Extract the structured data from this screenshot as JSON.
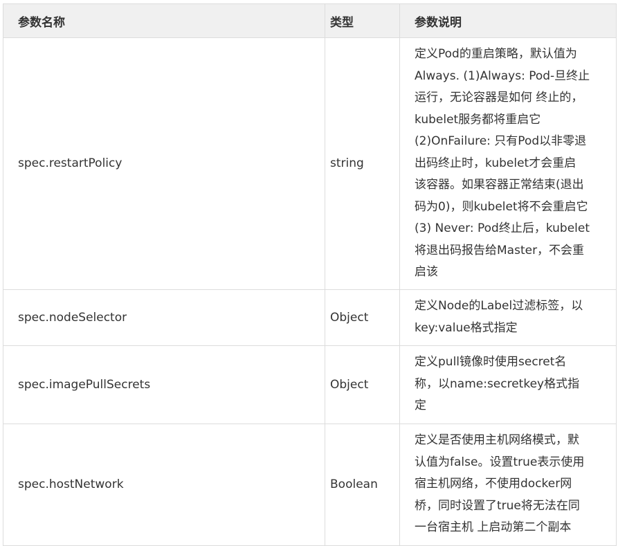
{
  "table": {
    "headers": {
      "name": "参数名称",
      "type": "类型",
      "desc": "参数说明"
    },
    "rows": [
      {
        "name": "spec.restartPolicy",
        "type": "string",
        "desc": "定义Pod的重启策略，默认值为\nAlways. (1)Always: Pod-旦终止\n运行，无论容器是如何 终止的，\nkubelet服务都将重启它\n(2)OnFailure: 只有Pod以非零退\n出码终止时，kubelet才会重启\n该容器。如果容器正常结束(退出\n码为0)，则kubelet将不会重启它\n(3) Never: Pod终止后，kubelet\n将退出码报告给Master，不会重\n启该"
      },
      {
        "name": "spec.nodeSelector",
        "type": "Object",
        "desc": "定义Node的Label过滤标签，以\nkey:value格式指定"
      },
      {
        "name": "spec.imagePullSecrets",
        "type": "Object",
        "desc": "定义pull镜像时使用secret名\n称，以name:secretkey格式指\n定"
      },
      {
        "name": "spec.hostNetwork",
        "type": "Boolean",
        "desc": "定义是否使用主机网络模式，默\n认值为false。设置true表示使用\n宿主机网络，不使用docker网\n桥，同时设置了true将无法在同\n一台宿主机 上启动第二个副本"
      }
    ]
  }
}
